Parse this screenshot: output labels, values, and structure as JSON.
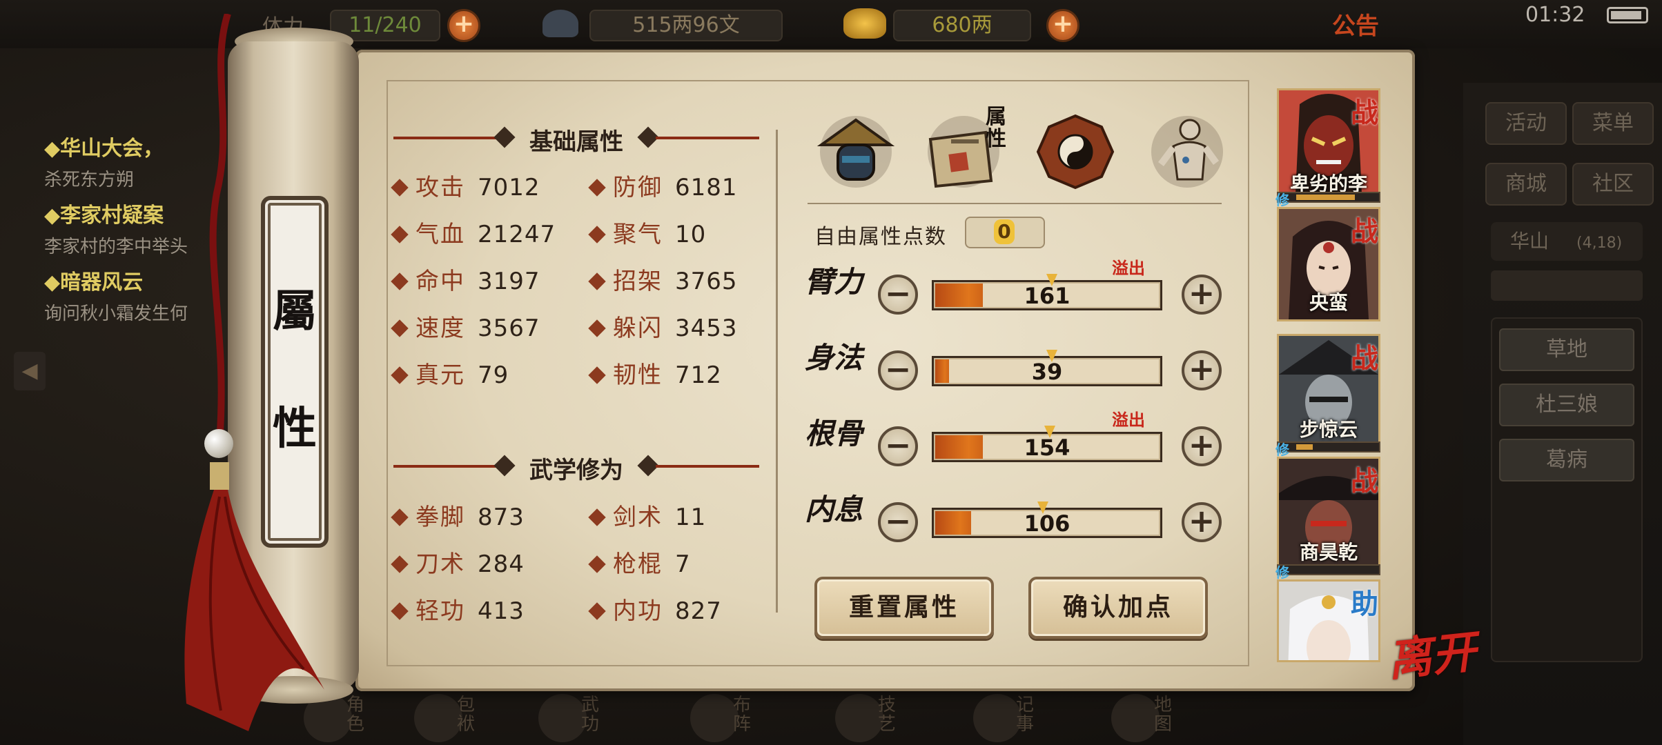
{
  "topbar": {
    "stamina_label": "体力",
    "stamina_value": "11/240",
    "silver": "515两96文",
    "gold": "680两",
    "notice": "公告",
    "clock": "01:32"
  },
  "quests": [
    {
      "title": "◆华山大会，",
      "desc": "杀死东方朔"
    },
    {
      "title": "◆李家村疑案",
      "desc": "李家村的李中举头"
    },
    {
      "title": "◆暗器风云",
      "desc": "询问秋小霜发生何"
    }
  ],
  "scroll_title": [
    "屬",
    "性"
  ],
  "basic_header": "基础属性",
  "basic_stats": [
    {
      "label": "攻击",
      "value": "7012"
    },
    {
      "label": "防御",
      "value": "6181"
    },
    {
      "label": "气血",
      "value": "21247"
    },
    {
      "label": "聚气",
      "value": "10"
    },
    {
      "label": "命中",
      "value": "3197"
    },
    {
      "label": "招架",
      "value": "3765"
    },
    {
      "label": "速度",
      "value": "3567"
    },
    {
      "label": "躲闪",
      "value": "3453"
    },
    {
      "label": "真元",
      "value": "79"
    },
    {
      "label": "韧性",
      "value": "712"
    }
  ],
  "martial_header": "武学修为",
  "martial_stats": [
    {
      "label": "拳脚",
      "value": "873"
    },
    {
      "label": "剑术",
      "value": "11"
    },
    {
      "label": "刀术",
      "value": "284"
    },
    {
      "label": "枪棍",
      "value": "7"
    },
    {
      "label": "轻功",
      "value": "413"
    },
    {
      "label": "内功",
      "value": "827"
    }
  ],
  "tabs": [
    {
      "icon": "hat-swordsman-icon"
    },
    {
      "icon": "scroll-attribute-icon",
      "label": "属性"
    },
    {
      "icon": "bagua-icon"
    },
    {
      "icon": "body-meridian-icon"
    }
  ],
  "free_points_label": "自由属性点数",
  "free_points": "0",
  "overflow_label": "溢出",
  "attributes": [
    {
      "name": "臂力",
      "value": "161",
      "fill": 0.21,
      "marker": 0.21,
      "overflow": true
    },
    {
      "name": "身法",
      "value": "39",
      "fill": 0.06,
      "marker": 0.21,
      "overflow": false
    },
    {
      "name": "根骨",
      "value": "154",
      "fill": 0.21,
      "marker": 0.2,
      "overflow": true
    },
    {
      "name": "内息",
      "value": "106",
      "fill": 0.16,
      "marker": 0.17,
      "overflow": false
    }
  ],
  "reset_button": "重置属性",
  "confirm_button": "确认加点",
  "party": [
    {
      "name": "卑劣的李",
      "badge": "战",
      "type": "war",
      "xiu": true,
      "xiu_progress": 0.72
    },
    {
      "name": "央蛮",
      "badge": "战",
      "type": "war",
      "xiu": false
    },
    {
      "name": "步惊云",
      "badge": "战",
      "type": "war",
      "xiu": true,
      "xiu_progress": 0.2
    },
    {
      "name": "商昊乾",
      "badge": "战",
      "type": "war",
      "xiu": true,
      "xiu_progress": 0.0
    },
    {
      "name": "",
      "badge": "助",
      "type": "help",
      "xiu": false
    }
  ],
  "xiu_label": "修",
  "leave_label": "离开",
  "right_menu": [
    "活动",
    "菜单",
    "商城",
    "社区"
  ],
  "location": {
    "name": "华山",
    "coord": "(4,18)"
  },
  "npcs": [
    "草地",
    "杜三娘",
    "葛病"
  ],
  "bottom_nav": [
    "角色",
    "包袱",
    "武功",
    "布阵",
    "技艺",
    "记事",
    "地图"
  ],
  "colors": {
    "accent_red": "#c8281c",
    "bar_orange": "#e0761c",
    "paper": "#e2d6ba",
    "help_blue": "#2a7bc8"
  }
}
